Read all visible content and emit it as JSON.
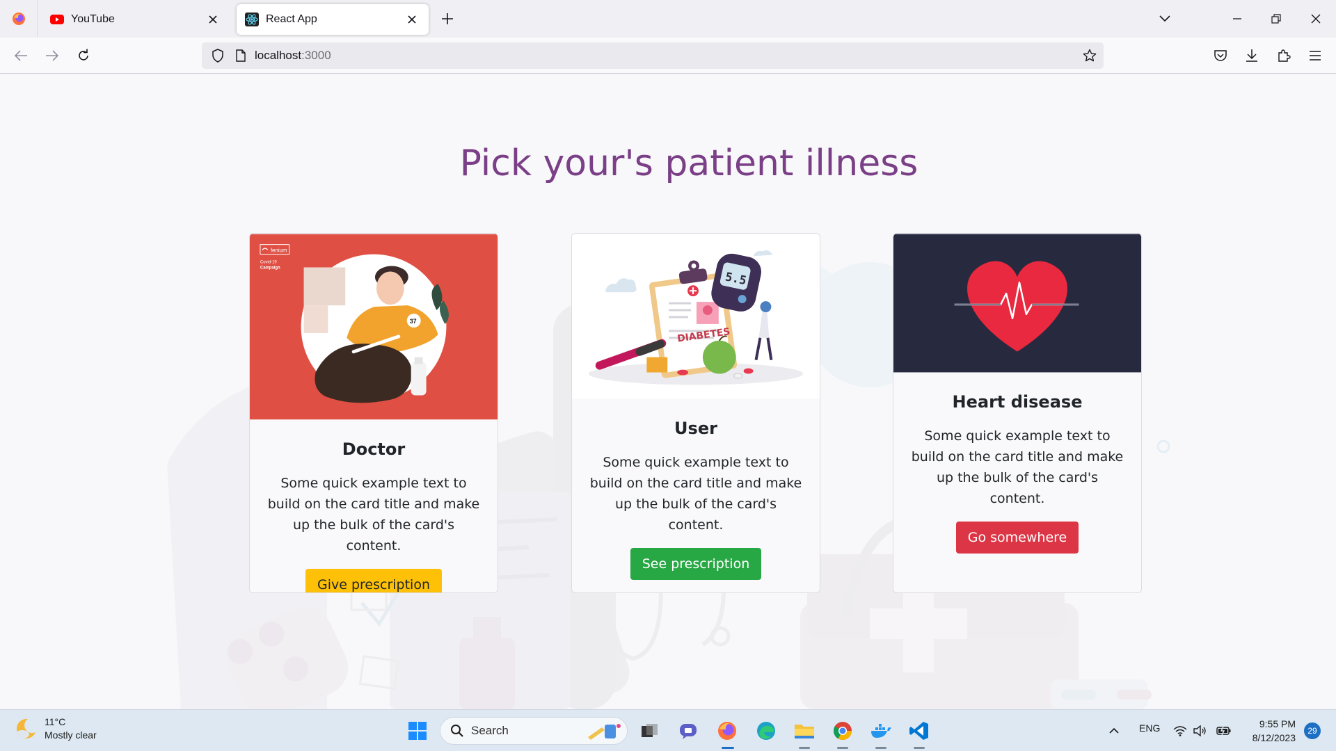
{
  "browser": {
    "tabs": [
      {
        "title": "YouTube",
        "active": false
      },
      {
        "title": "React App",
        "active": true
      }
    ],
    "url_host": "localhost",
    "url_port": ":3000"
  },
  "page": {
    "heading": "Pick your's patient illness",
    "cards": [
      {
        "title": "Doctor",
        "text": "Some quick example text to build on the card title and make up the bulk of the card's content.",
        "button": "Give prescription",
        "button_color": "#ffc107",
        "image_caption_brand": "fenium",
        "image_caption_line1": "Covid-19",
        "image_caption_line2": "Campaign",
        "image_badge": "37"
      },
      {
        "title": "User",
        "text": "Some quick example text to build on the card title and make up the bulk of the card's content.",
        "button": "See prescription",
        "button_color": "#28a745",
        "image_label": "DIABETES",
        "image_meter_value": "5.5"
      },
      {
        "title": "Heart disease",
        "text": "Some quick example text to build on the card title and make up the bulk of the card's content.",
        "button": "Go somewhere",
        "button_color": "#dc3545"
      }
    ],
    "title_color": "#7a3f86"
  },
  "taskbar": {
    "weather_temp": "11°C",
    "weather_desc": "Mostly clear",
    "search_label": "Search",
    "language": "ENG",
    "time": "9:55 PM",
    "date": "8/12/2023",
    "notification_count": "29"
  }
}
